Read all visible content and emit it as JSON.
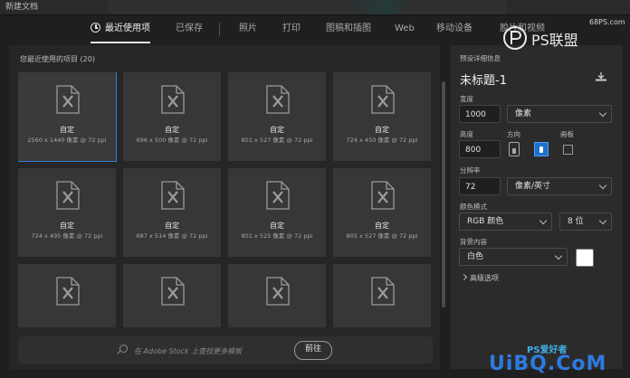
{
  "window": {
    "title": "新建文档"
  },
  "tabs": [
    {
      "label": "最近使用项",
      "active": true
    },
    {
      "label": "已保存"
    },
    {
      "label": "照片"
    },
    {
      "label": "打印"
    },
    {
      "label": "图稿和插图"
    },
    {
      "label": "Web"
    },
    {
      "label": "移动设备"
    },
    {
      "label": "胶片和视频"
    }
  ],
  "recent": {
    "heading": "您最近使用的项目",
    "count": "(20)",
    "items": [
      {
        "name": "自定",
        "dims": "2560 x 1440 像素 @ 72 ppi",
        "selected": true
      },
      {
        "name": "自定",
        "dims": "696 x 500 像素 @ 72 ppi"
      },
      {
        "name": "自定",
        "dims": "801 x 527 像素 @ 72 ppi"
      },
      {
        "name": "自定",
        "dims": "724 x 450 像素 @ 72 ppi"
      },
      {
        "name": "自定",
        "dims": "724 x 495 像素 @ 72 ppi"
      },
      {
        "name": "自定",
        "dims": "687 x 514 像素 @ 72 ppi"
      },
      {
        "name": "自定",
        "dims": "801 x 525 像素 @ 72 ppi"
      },
      {
        "name": "自定",
        "dims": "805 x 527 像素 @ 72 ppi"
      },
      {
        "name": "",
        "dims": ""
      },
      {
        "name": "",
        "dims": ""
      },
      {
        "name": "",
        "dims": ""
      },
      {
        "name": "",
        "dims": ""
      }
    ]
  },
  "search": {
    "placeholder": "在 Adobe Stock 上查找更多模板",
    "go_label": "前往"
  },
  "details": {
    "section": "预设详细信息",
    "doc_title": "未标题-1",
    "width_label": "宽度",
    "width_value": "1000",
    "width_unit": "像素",
    "height_label": "高度",
    "height_value": "800",
    "orientation_label": "方向",
    "artboard_label": "画板",
    "resolution_label": "分辨率",
    "resolution_value": "72",
    "resolution_unit": "像素/英寸",
    "color_mode_label": "颜色模式",
    "color_mode_value": "RGB 颜色",
    "bit_depth": "8 位",
    "background_label": "背景内容",
    "background_value": "白色",
    "background_color": "#ffffff",
    "advanced_label": "高级选项"
  },
  "watermarks": {
    "logo_text": "PS联盟",
    "site": "68PS.com",
    "bottom": "UiBQ.CoM",
    "bottom_ps": "PS爱好者"
  },
  "colors": {
    "accent": "#2e7fd9",
    "panel": "#2b2b2b",
    "background": "#1f1f1f"
  }
}
